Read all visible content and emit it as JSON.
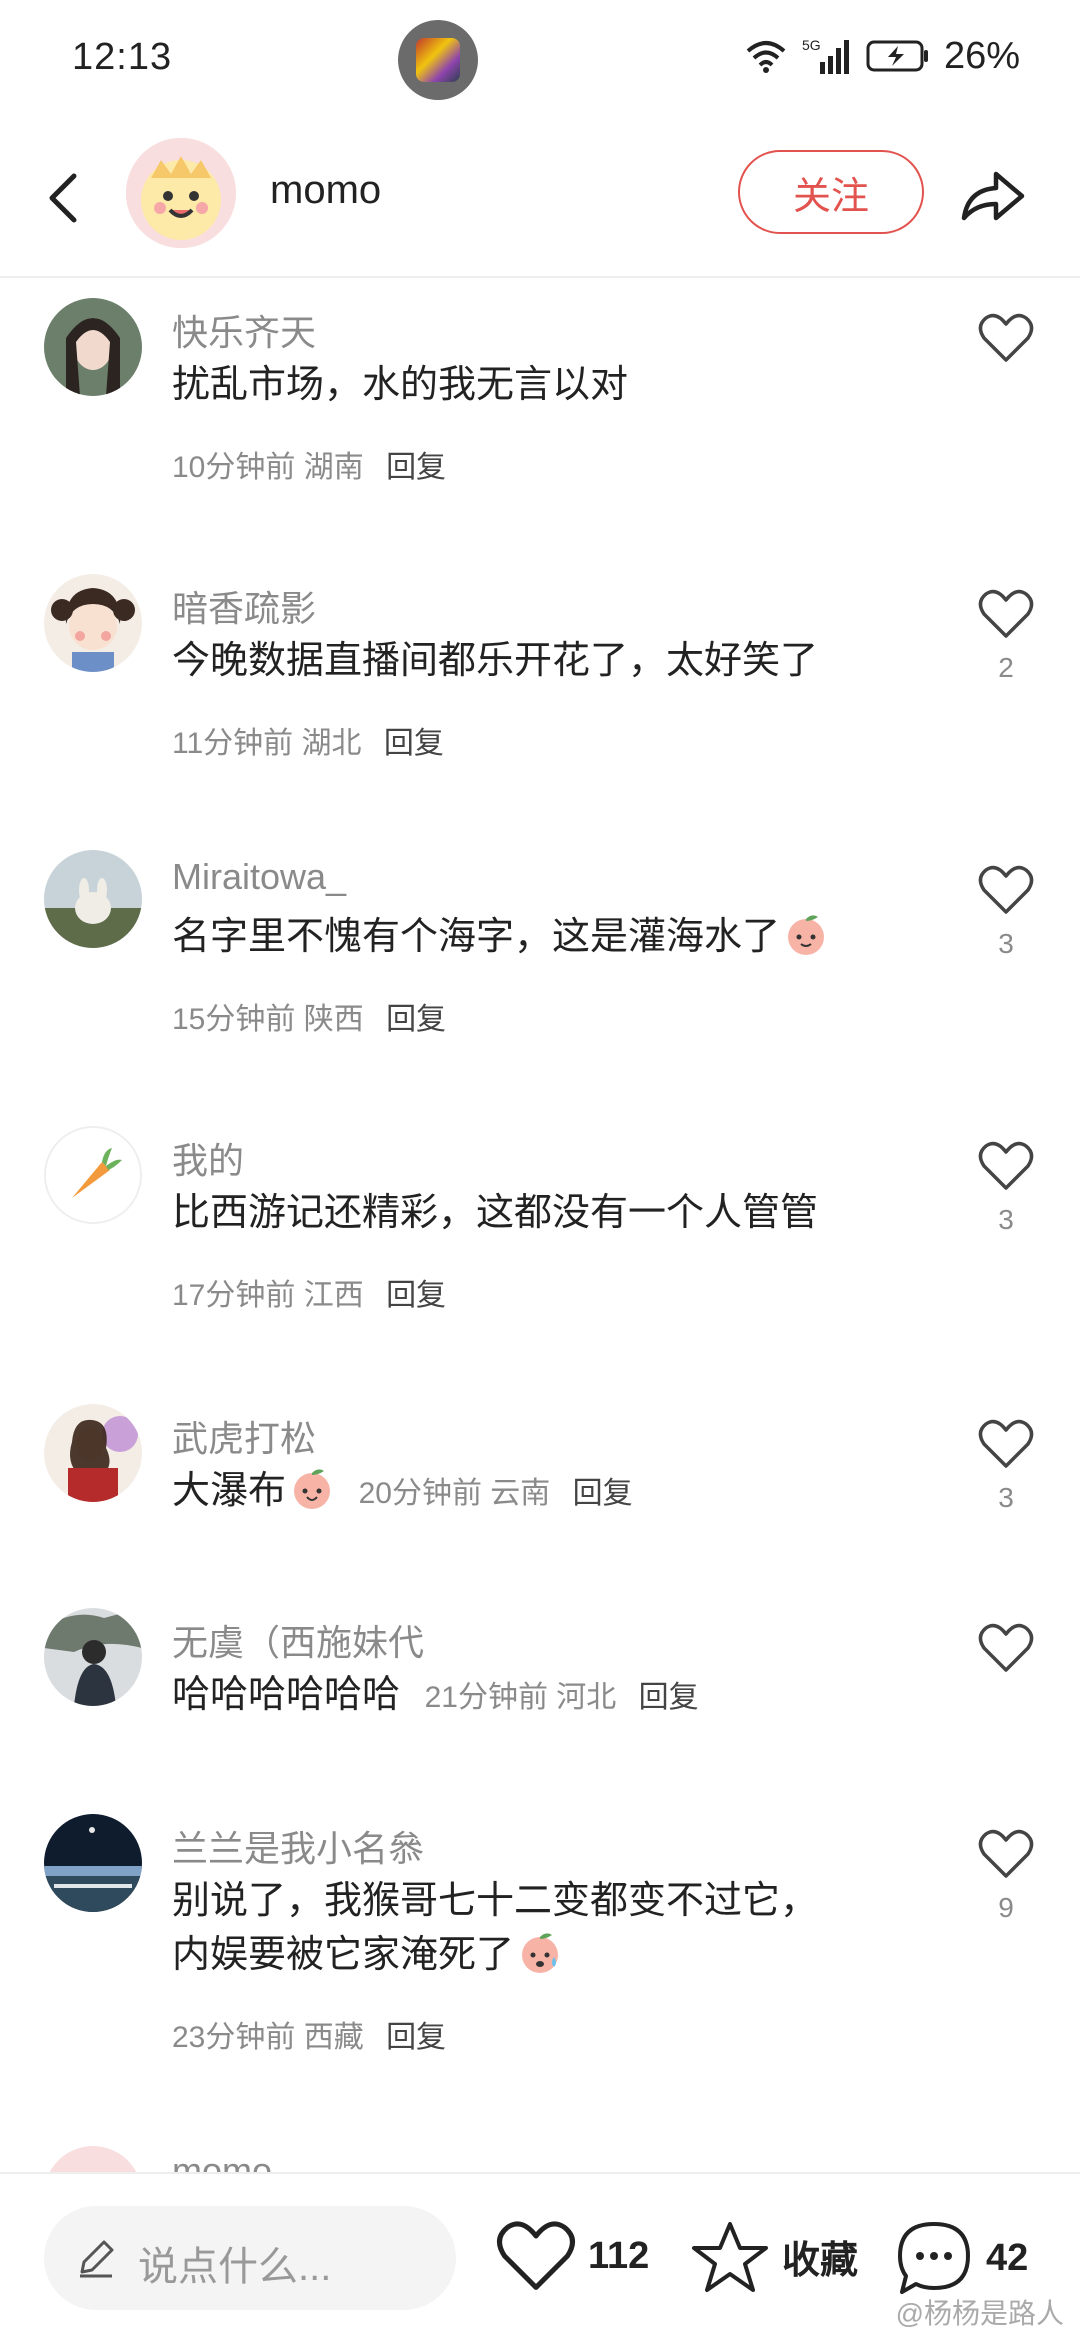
{
  "status_bar": {
    "time": "12:13",
    "network": "5G",
    "battery": "26%"
  },
  "header": {
    "username": "momo",
    "follow_label": "关注"
  },
  "comments": [
    {
      "user": "快乐齐天",
      "text": "扰乱市场，水的我无言以对",
      "time": "10分钟前",
      "location": "湖南",
      "reply": "回复",
      "likes": ""
    },
    {
      "user": "暗香疏影",
      "text": "今晚数据直播间都乐开花了，太好笑了",
      "time": "11分钟前",
      "location": "湖北",
      "reply": "回复",
      "likes": "2"
    },
    {
      "user": "Miraitowa_",
      "text": "名字里不愧有个海字，这是灌海水了",
      "time": "15分钟前",
      "location": "陕西",
      "reply": "回复",
      "likes": "3"
    },
    {
      "user": "我的",
      "text": "比西游记还精彩，这都没有一个人管管",
      "time": "17分钟前",
      "location": "江西",
      "reply": "回复",
      "likes": "3"
    },
    {
      "user": "武虎打松",
      "text": "大瀑布",
      "time": "20分钟前",
      "location": "云南",
      "reply": "回复",
      "likes": "3"
    },
    {
      "user": "无虞（西施妹代",
      "text": "哈哈哈哈哈哈",
      "time": "21分钟前",
      "location": "河北",
      "reply": "回复",
      "likes": ""
    },
    {
      "user": "兰兰是我小名叅",
      "text_line1": "别说了，我猴哥七十二变都变不过它，",
      "text_line2": "内娱要被它家淹死了",
      "time": "23分钟前",
      "location": "西藏",
      "reply": "回复",
      "likes": "9"
    },
    {
      "user": "momo"
    }
  ],
  "bottom_bar": {
    "input_placeholder": "说点什么...",
    "likes_count": "112",
    "favorite_label": "收藏",
    "comments_count": "42"
  },
  "watermark": "@杨杨是路人",
  "colors": {
    "accent": "#e2534f",
    "secondary_text": "#8a8a8a"
  },
  "icons": [
    "back-icon",
    "share-icon",
    "heart-icon",
    "star-icon",
    "comment-bubble-icon",
    "pen-icon",
    "wifi-icon",
    "signal-icon",
    "battery-icon"
  ]
}
